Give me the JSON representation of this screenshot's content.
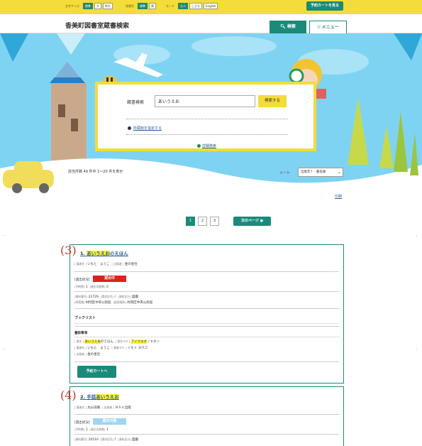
{
  "topbar": {
    "font_size_label": "文字サイズ",
    "font_sizes": [
      "標準",
      "大",
      "特大"
    ],
    "bg_color_label": "背景色",
    "bg_colors": [
      "標準",
      "黒"
    ],
    "mode_label": "モード",
    "modes": [
      "大人",
      "こども",
      "English"
    ],
    "cart_button": "予約カートを見る"
  },
  "header": {
    "site_title": "香美町図書室蔵書検索",
    "search_tab": "検索",
    "menu_tab": "メニュー"
  },
  "search": {
    "label": "蔵書検索",
    "query": "あいうえお",
    "button": "検索する",
    "library_link": "所蔵館を指定する",
    "detail_link": "詳細検索"
  },
  "results": {
    "count_text": "該当件数 49 件中 1～20 件を表示",
    "sort_label": "ソート",
    "sort_value": "出版年↑ - 書名順",
    "print_link": "印刷"
  },
  "pagination": {
    "pages": [
      "1",
      "2",
      "3"
    ],
    "next": "次のページ"
  },
  "items": [
    {
      "annotation": "(3)",
      "index": "1.",
      "title_hl": "あいうえお",
      "title_rest": "のえほん",
      "author_key": "[ 著者名 ]",
      "author": "いもと　ようこ",
      "publisher_key": "[ 出版者 ]",
      "publisher": "金の星社",
      "status_key": "[貸出状況]",
      "status": "貸出中",
      "reserve_key": "[予約数]",
      "reserve": "1",
      "reserve_avail_key": "[貸出可能数]",
      "reserve_avail": "0",
      "shelf_key": "[資料番号]",
      "shelf": "22729",
      "class_key": "[請求記号]",
      "class": "ｲ",
      "type_key": "[資料区分]",
      "type": "図書",
      "loc_key": "[所蔵館]",
      "loc": "村岡区中央公民館",
      "loc2_key": "[配架場所]",
      "loc2": "村岡区中央公民館",
      "booklist": "ブックリスト",
      "bib": "書誌事項",
      "bib_title_key": "[ 書名 ]",
      "bib_title_hl": "あいうえお",
      "bib_title_rest": "のえほん",
      "bib_kana_key": "[ 書名ヨミ ]",
      "bib_kana_hl": "アイウエオ",
      "bib_kana_rest": "ノエホン",
      "bib_author_key": "[ 著者名 ]",
      "bib_author": "いもと　ようこ",
      "bib_author_kana_key": "[ 著者ヨミ ]",
      "bib_author_kana": "イモト ヨウコ",
      "bib_pub_key": "[ 出版者 ]",
      "bib_pub": "金の星社",
      "cart": "予約カートへ"
    },
    {
      "annotation": "(4)",
      "index": "2.",
      "title_prefix": "手話",
      "title_hl": "あいうえお",
      "author_key": "[ 著者名 ]",
      "author": "丸山浩路",
      "publisher_key": "[ 出版者 ]",
      "publisher": "Ｎｈｋ出版",
      "status_key": "[貸出状況]",
      "status": "貸出可能",
      "reserve_key": "[予約数]",
      "reserve": "1",
      "reserve_avail_key": "[貸出可能数]",
      "reserve_avail": "1",
      "shelf_key": "[資料番号]",
      "shelf": "20510",
      "class_key": "[請求記号]",
      "class": "ﾃ",
      "type_key": "[資料区分]",
      "type": "図書"
    }
  ],
  "colors": {
    "accent": "#1a8a7a",
    "yellow": "#f4dc3a",
    "sky": "#7fd3f2",
    "highlight": "#ffef33",
    "status_out": "#e02020",
    "status_ok": "#9dd6f2"
  }
}
